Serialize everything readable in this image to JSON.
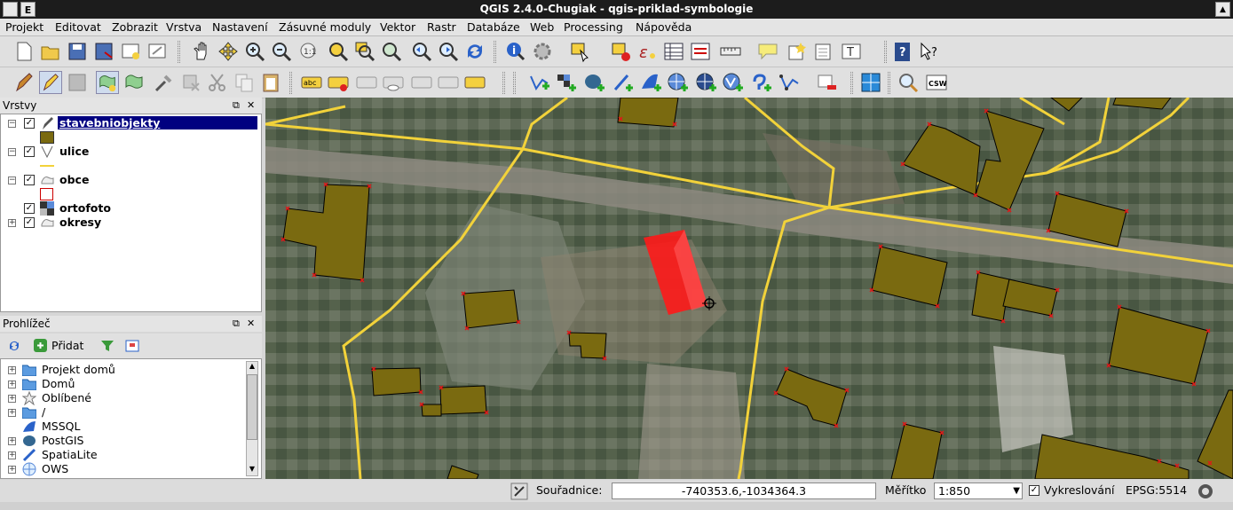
{
  "window": {
    "title": "QGIS 2.4.0-Chugiak - qgis-priklad-symbologie",
    "sys_button": "E"
  },
  "menu": [
    "Projekt",
    "Editovat",
    "Zobrazit",
    "Vrstva",
    "Nastavení",
    "Zásuvné moduly",
    "Vektor",
    "Rastr",
    "Databáze",
    "Web",
    "Processing",
    "Nápověda"
  ],
  "layers_panel": {
    "title": "Vrstvy",
    "layers": [
      {
        "name": "stavebniobjekty",
        "checked": true,
        "selected": true
      },
      {
        "name": "ulice",
        "checked": true
      },
      {
        "name": "obce",
        "checked": true
      },
      {
        "name": "ortofoto",
        "checked": true
      },
      {
        "name": "okresy",
        "checked": true
      }
    ]
  },
  "browser_panel": {
    "title": "Prohlížeč",
    "add_label": "Přidat",
    "items": [
      "Projekt domů",
      "Domů",
      "Oblíbené",
      "/",
      "MSSQL",
      "PostGIS",
      "SpatiaLite",
      "OWS"
    ]
  },
  "toolbar_extra": {
    "csw": "CSW",
    "abc": "abc"
  },
  "statusbar": {
    "coord_label": "Souřadnice:",
    "coord_value": "-740353.6,-1034364.3",
    "scale_label": "Měřítko",
    "scale_value": "1:850",
    "render_label": "Vykreslování",
    "crs": "EPSG:5514"
  },
  "colors": {
    "building_fill": "#7a6a10",
    "street": "#f2d23a",
    "edit_polygon": "#ff1a1a",
    "selection": "#000080"
  }
}
